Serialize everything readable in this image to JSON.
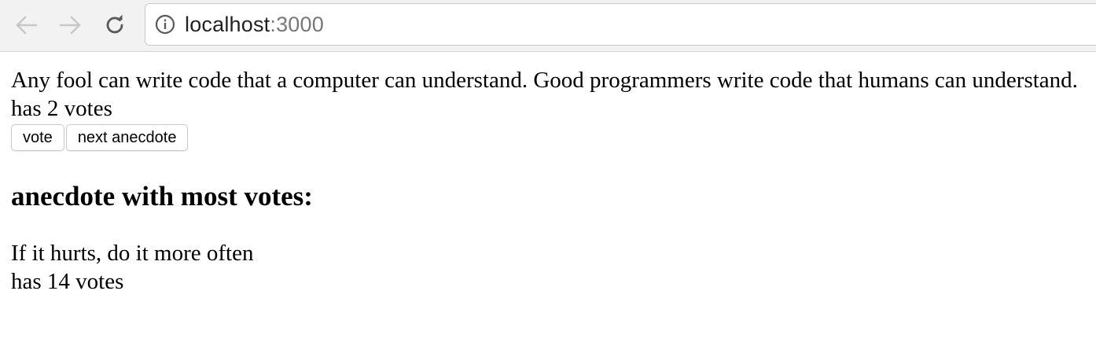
{
  "browser": {
    "back_icon": "arrow-left-icon",
    "forward_icon": "arrow-right-icon",
    "reload_icon": "reload-icon",
    "info_icon": "info-icon",
    "url_host": "localhost",
    "url_port": ":3000"
  },
  "page": {
    "anecdote": "Any fool can write code that a computer can understand. Good programmers write code that humans can understand.",
    "votes": "has 2 votes",
    "vote_button": "vote",
    "next_button": "next anecdote",
    "most_votes_heading": "anecdote with most votes:",
    "top_anecdote": "If it hurts, do it more often",
    "top_votes": "has 14 votes"
  },
  "colors": {
    "toolbar_bg": "#f2f2f2",
    "url_port": "#777777"
  }
}
